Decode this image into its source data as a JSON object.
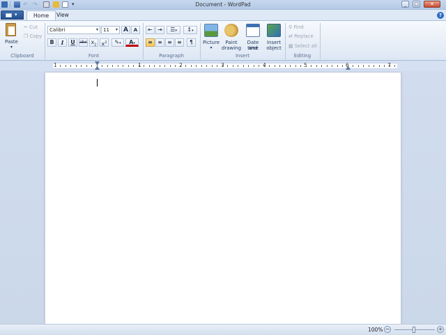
{
  "window": {
    "title": "Document - WordPad"
  },
  "tabs": [
    {
      "label": "Home",
      "active": true
    },
    {
      "label": "View",
      "active": false
    }
  ],
  "ribbon": {
    "clipboard": {
      "paste": "Paste",
      "cut": "Cut",
      "copy": "Copy",
      "group": "Clipboard"
    },
    "font": {
      "family": "Calibri",
      "size": "11",
      "group": "Font",
      "grow": "A",
      "shrink": "A",
      "bold": "B",
      "italic": "I",
      "underline": "U",
      "strike": "abc",
      "subscript": "x",
      "superscript": "x",
      "color": "A"
    },
    "paragraph": {
      "group": "Paragraph"
    },
    "insert": {
      "picture": "Picture",
      "paint": [
        "Paint",
        "drawing"
      ],
      "datetime": [
        "Date and",
        "time"
      ],
      "object": [
        "Insert",
        "object"
      ],
      "group": "Insert"
    },
    "editing": {
      "find": "Find",
      "replace": "Replace",
      "select_all": "Select all",
      "group": "Editing"
    }
  },
  "ruler": {
    "numbers": [
      "1",
      "1",
      "2",
      "3",
      "4",
      "5",
      "6",
      "7"
    ]
  },
  "status": {
    "zoom": "100%",
    "minus": "−",
    "plus": "+"
  },
  "colors": {
    "accent": "#2b5797",
    "page": "#ffffff",
    "workspace": "#d0dcee"
  }
}
